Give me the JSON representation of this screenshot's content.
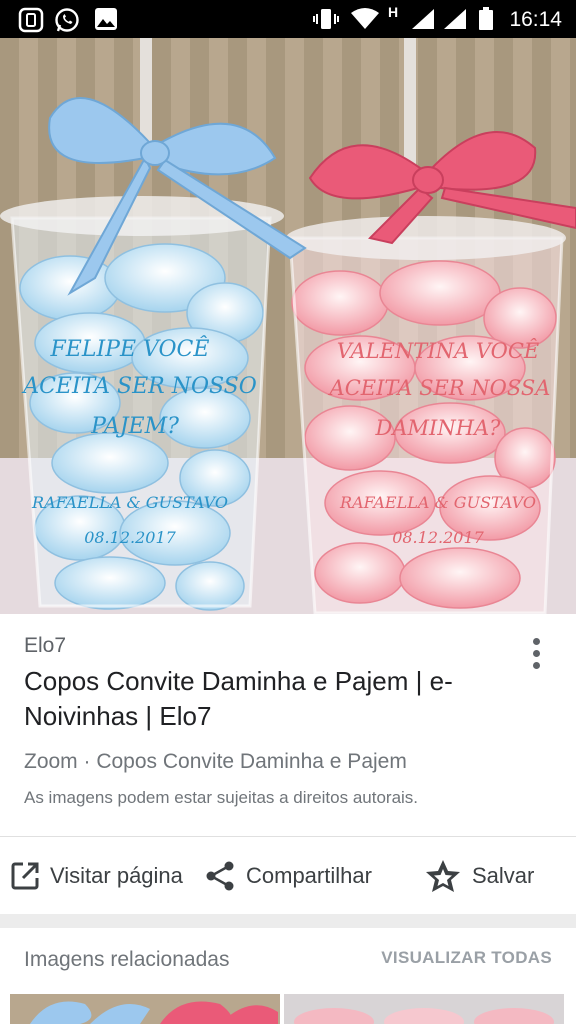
{
  "status_bar": {
    "time": "16:14",
    "network_label": "H"
  },
  "image": {
    "left_cup_text": [
      "FELIPE VOCÊ",
      "ACEITA SER NOSSO",
      "PAJEM?",
      "RAFAELLA & GUSTAVO",
      "08.12.2017"
    ],
    "right_cup_text": [
      "VALENTINA VOCÊ",
      "ACEITA SER NOSSA",
      "DAMINHA?",
      "RAFAELLA & GUSTAVO",
      "08.12.2017"
    ],
    "colors": {
      "blue_ribbon": "#9cc8ee",
      "pink_ribbon": "#ea5a78",
      "wall": "#b9a88e",
      "table": "#e6dbe0"
    }
  },
  "result": {
    "source": "Elo7",
    "title": "Copos Convite Daminha e Pajem | e-Noivinhas | Elo7",
    "subtitle": "Zoom · Copos Convite Daminha e Pajem",
    "copyright": "As imagens podem estar sujeitas a direitos autorais."
  },
  "actions": {
    "visit": {
      "label": "Visitar página",
      "icon": "open-in-new-icon"
    },
    "share": {
      "label": "Compartilhar",
      "icon": "share-icon"
    },
    "save": {
      "label": "Salvar",
      "icon": "star-outline-icon"
    }
  },
  "related": {
    "label": "Imagens relacionadas",
    "view_all": "VISUALIZAR TODAS"
  }
}
